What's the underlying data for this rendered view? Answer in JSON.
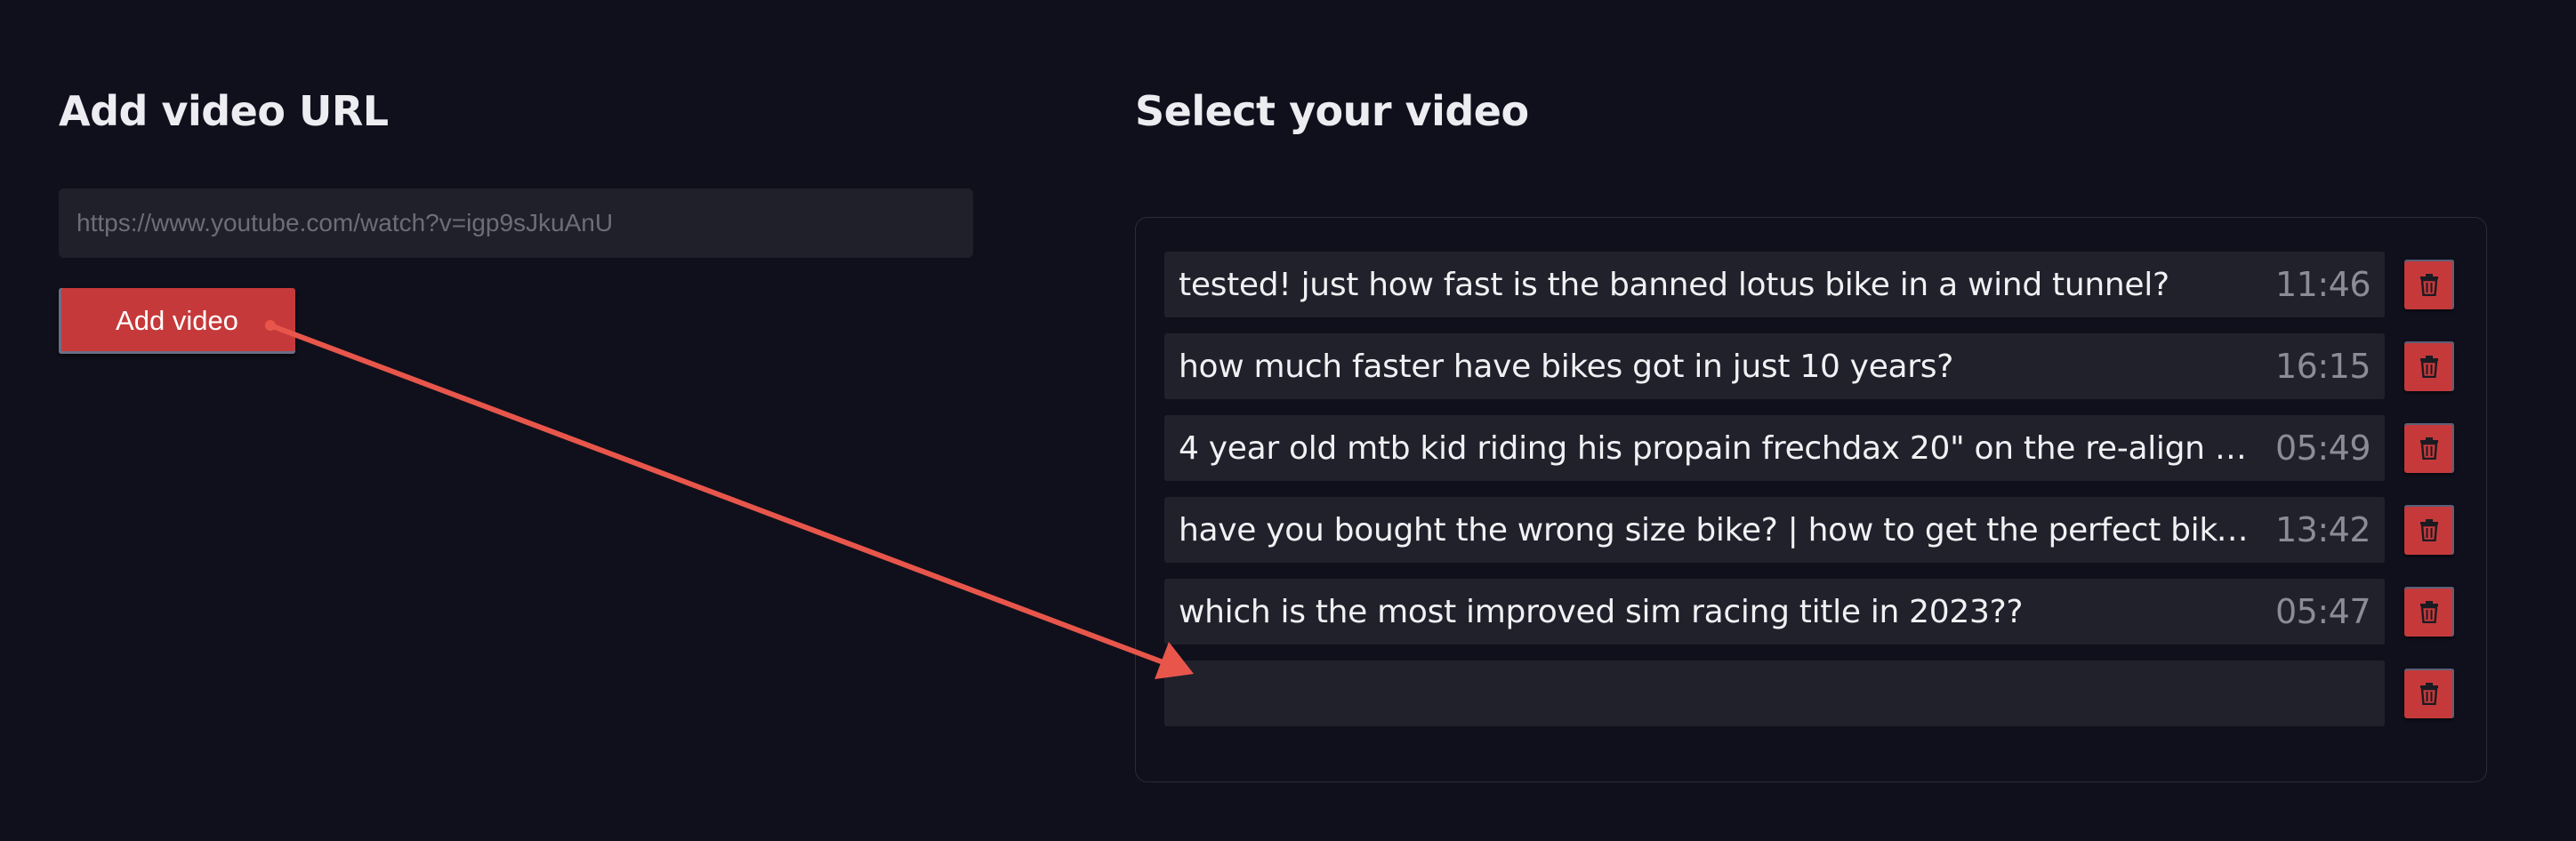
{
  "left": {
    "heading": "Add video URL",
    "url_input": {
      "value": "",
      "placeholder": "https://www.youtube.com/watch?v=igp9sJkuAnU"
    },
    "add_button_label": "Add video"
  },
  "right": {
    "heading": "Select your video",
    "videos": [
      {
        "title": "tested! just how fast is the banned lotus bike in a wind tunnel?",
        "duration": "11:46"
      },
      {
        "title": "how much faster have bikes got in just 10 years?",
        "duration": "16:15"
      },
      {
        "title": "4 year old mtb kid riding his propain frechdax 20\" on the re-align …",
        "duration": "05:49"
      },
      {
        "title": "have you bought the wrong size bike? | how to get the perfect bike…",
        "duration": "13:42"
      },
      {
        "title": "which is the most improved sim racing title in 2023??",
        "duration": "05:47"
      },
      {
        "title": "",
        "duration": ""
      }
    ],
    "delete_icon": "trash-icon"
  },
  "annotation": {
    "icon": "arrow-annotation",
    "color": "#e8564b"
  },
  "colors": {
    "background": "#0f101b",
    "accent": "#c6393a",
    "row_background": "#20212b",
    "panel_border": "#2a2b36"
  }
}
